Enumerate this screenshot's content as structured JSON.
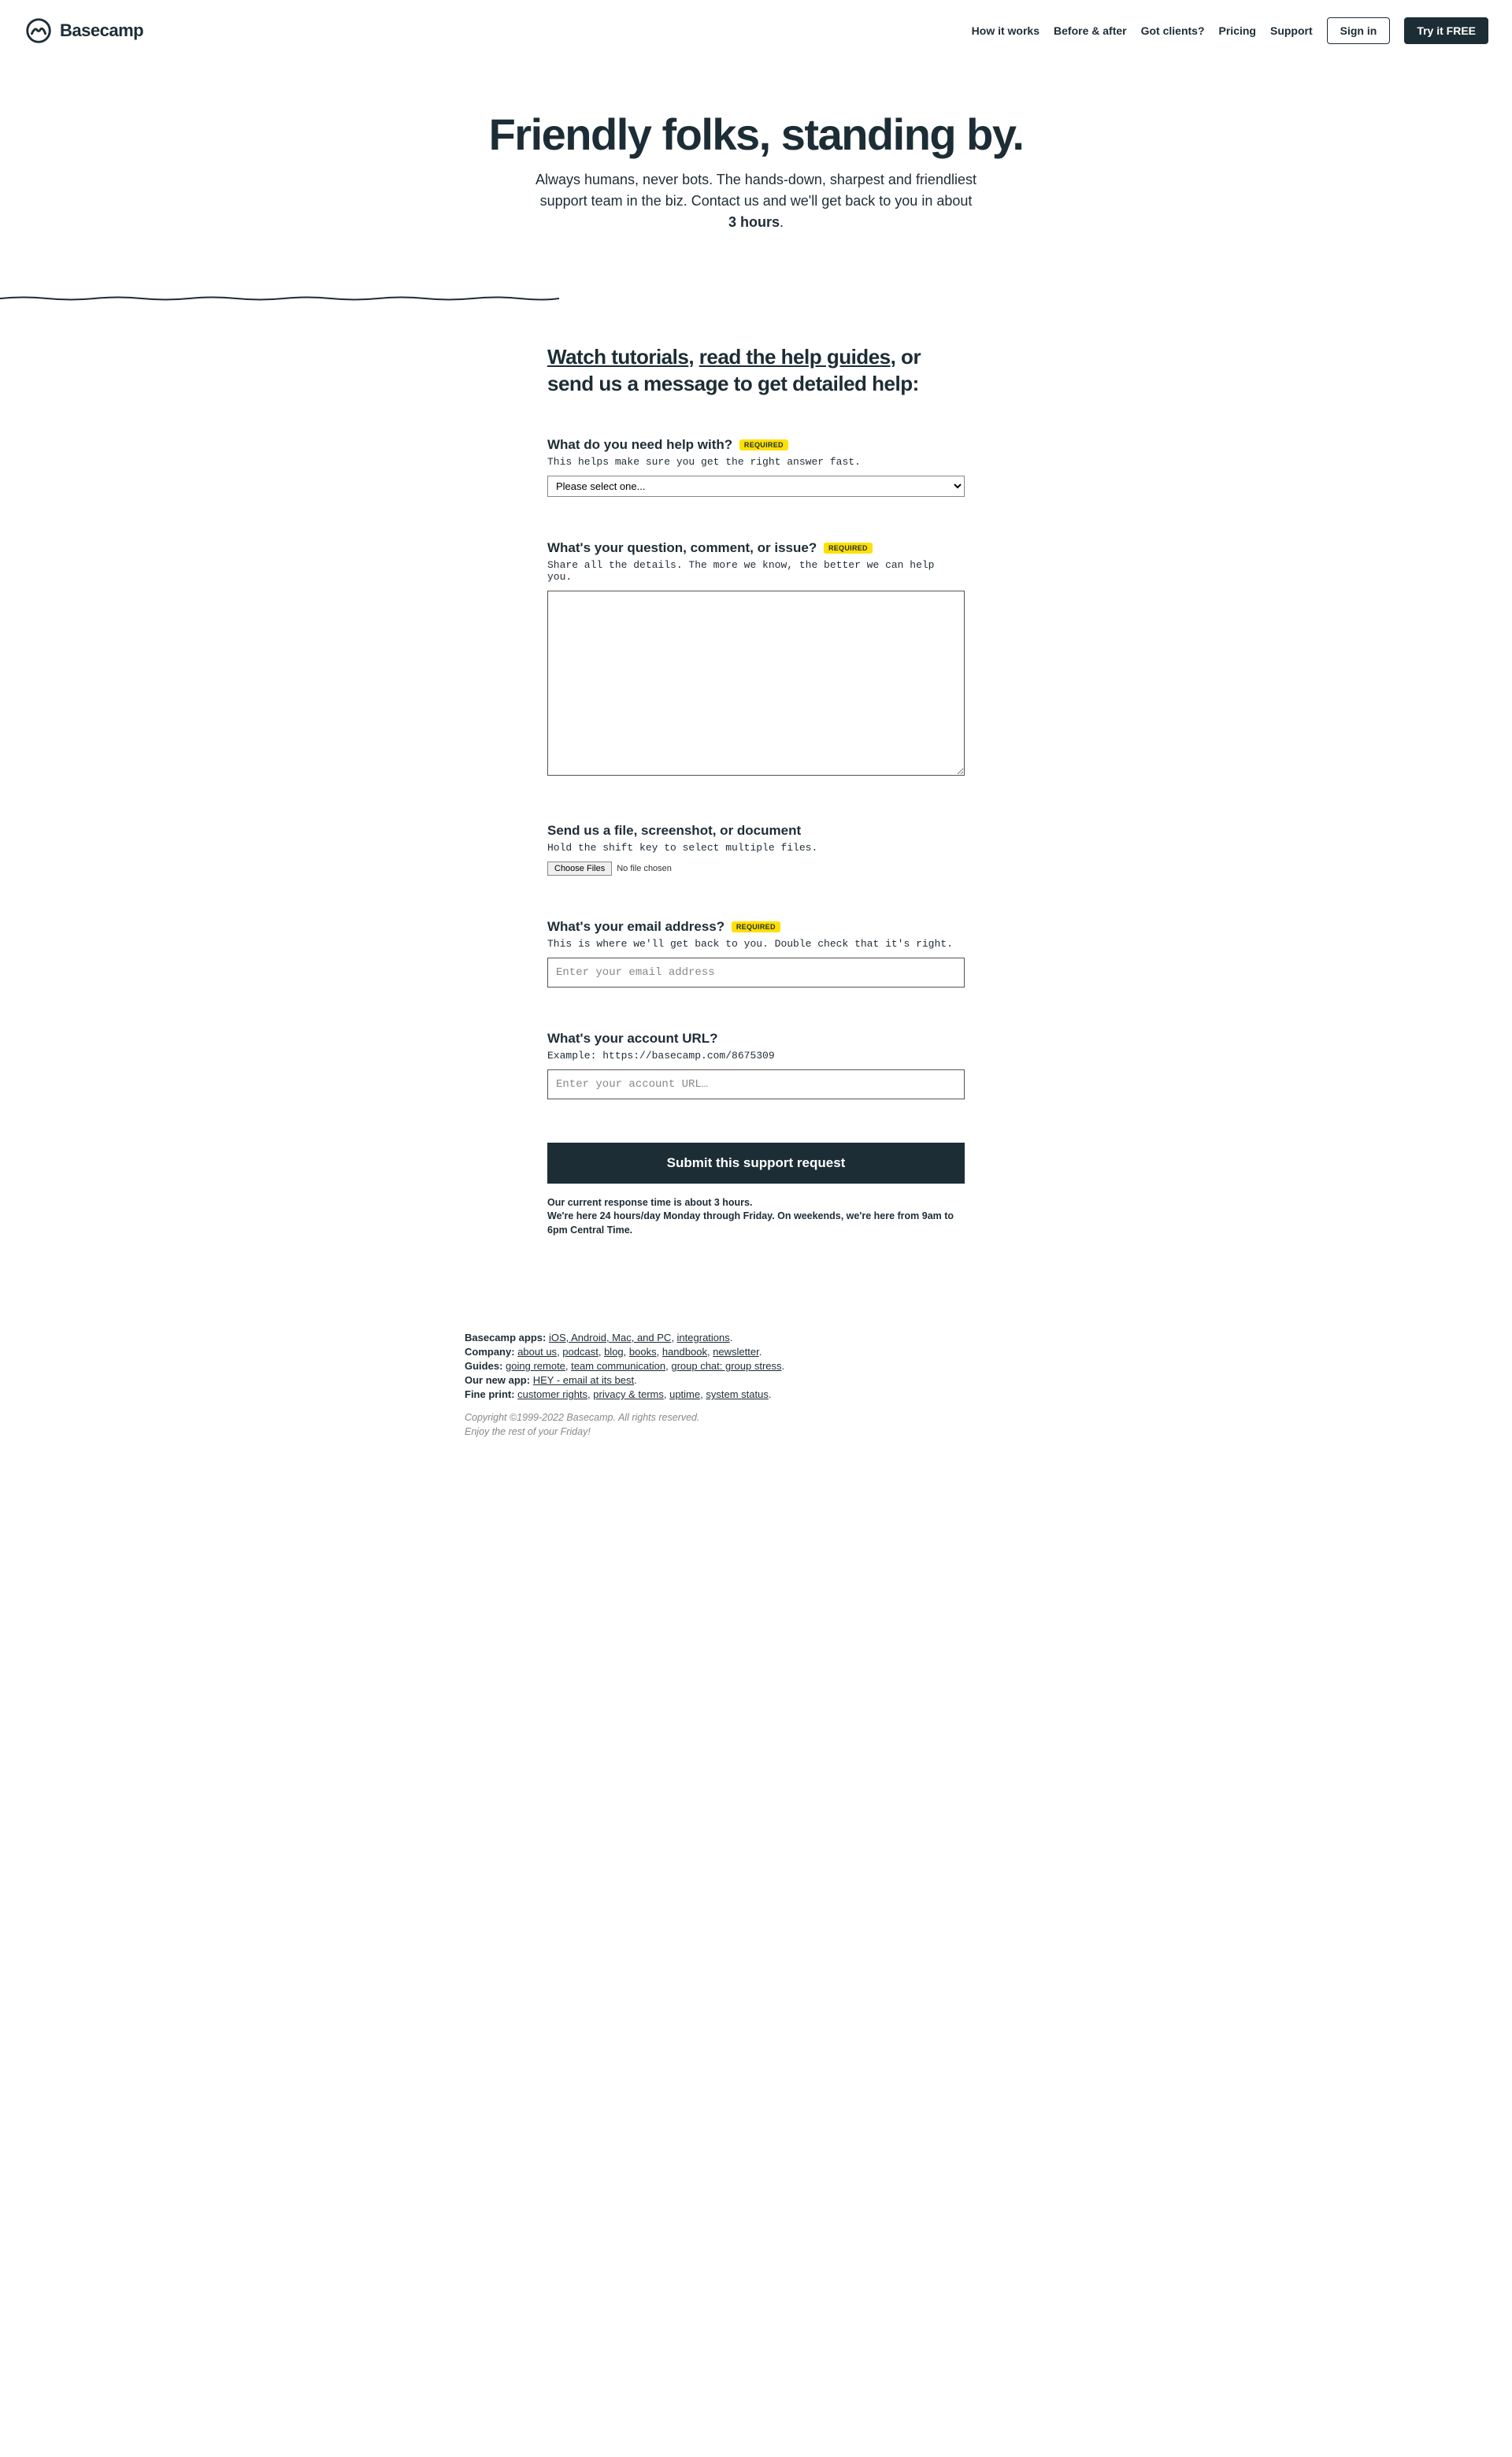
{
  "header": {
    "brand": "Basecamp",
    "nav": [
      "How it works",
      "Before & after",
      "Got clients?",
      "Pricing",
      "Support"
    ],
    "signin": "Sign in",
    "try": "Try it FREE"
  },
  "hero": {
    "title": "Friendly folks, standing by.",
    "sub_pre": "Always humans, never bots. The hands-down, sharpest and friendliest support team in the biz. Contact us and we'll get back to you in about ",
    "sub_bold": "3 hours",
    "sub_post": "."
  },
  "intro": {
    "link1": "Watch tutorials",
    "sep": ", ",
    "link2": "read the help guides",
    "rest": ", or send us a message to get detailed help:"
  },
  "form": {
    "required_badge": "REQUIRED",
    "topic": {
      "label": "What do you need help with?",
      "help": "This helps make sure you get the right answer fast.",
      "selected": "Please select one..."
    },
    "question": {
      "label": "What's your question, comment, or issue?",
      "help": "Share all the details. The more we know, the better we can help you."
    },
    "file": {
      "label": "Send us a file, screenshot, or document",
      "help": "Hold the shift key to select multiple files.",
      "button": "Choose Files",
      "status": "No file chosen"
    },
    "email": {
      "label": "What's your email address?",
      "help": "This is where we'll get back to you. Double check that it's right.",
      "placeholder": "Enter your email address"
    },
    "url": {
      "label": "What's your account URL?",
      "help": "Example: https://basecamp.com/8675309",
      "placeholder": "Enter your account URL…"
    },
    "submit": "Submit this support request",
    "note1": "Our current response time is about 3 hours.",
    "note2": "We're here 24 hours/day Monday through Friday. On weekends, we're here from 9am to 6pm Central Time."
  },
  "footer": {
    "apps": {
      "label": "Basecamp apps:",
      "links": [
        "iOS, Android, Mac, and PC",
        "integrations"
      ]
    },
    "company": {
      "label": "Company:",
      "links": [
        "about us",
        "podcast",
        "blog",
        "books",
        "handbook",
        "newsletter"
      ]
    },
    "guides": {
      "label": "Guides:",
      "links": [
        "going remote",
        "team communication",
        "group chat: group stress"
      ]
    },
    "newapp": {
      "label": "Our new app:",
      "links": [
        "HEY - email at its best"
      ]
    },
    "fineprint": {
      "label": "Fine print:",
      "links": [
        "customer rights",
        "privacy & terms",
        "uptime",
        "system status"
      ]
    },
    "copyright1": "Copyright ©1999-2022 Basecamp. All rights reserved.",
    "copyright2": "Enjoy the rest of your Friday!"
  }
}
